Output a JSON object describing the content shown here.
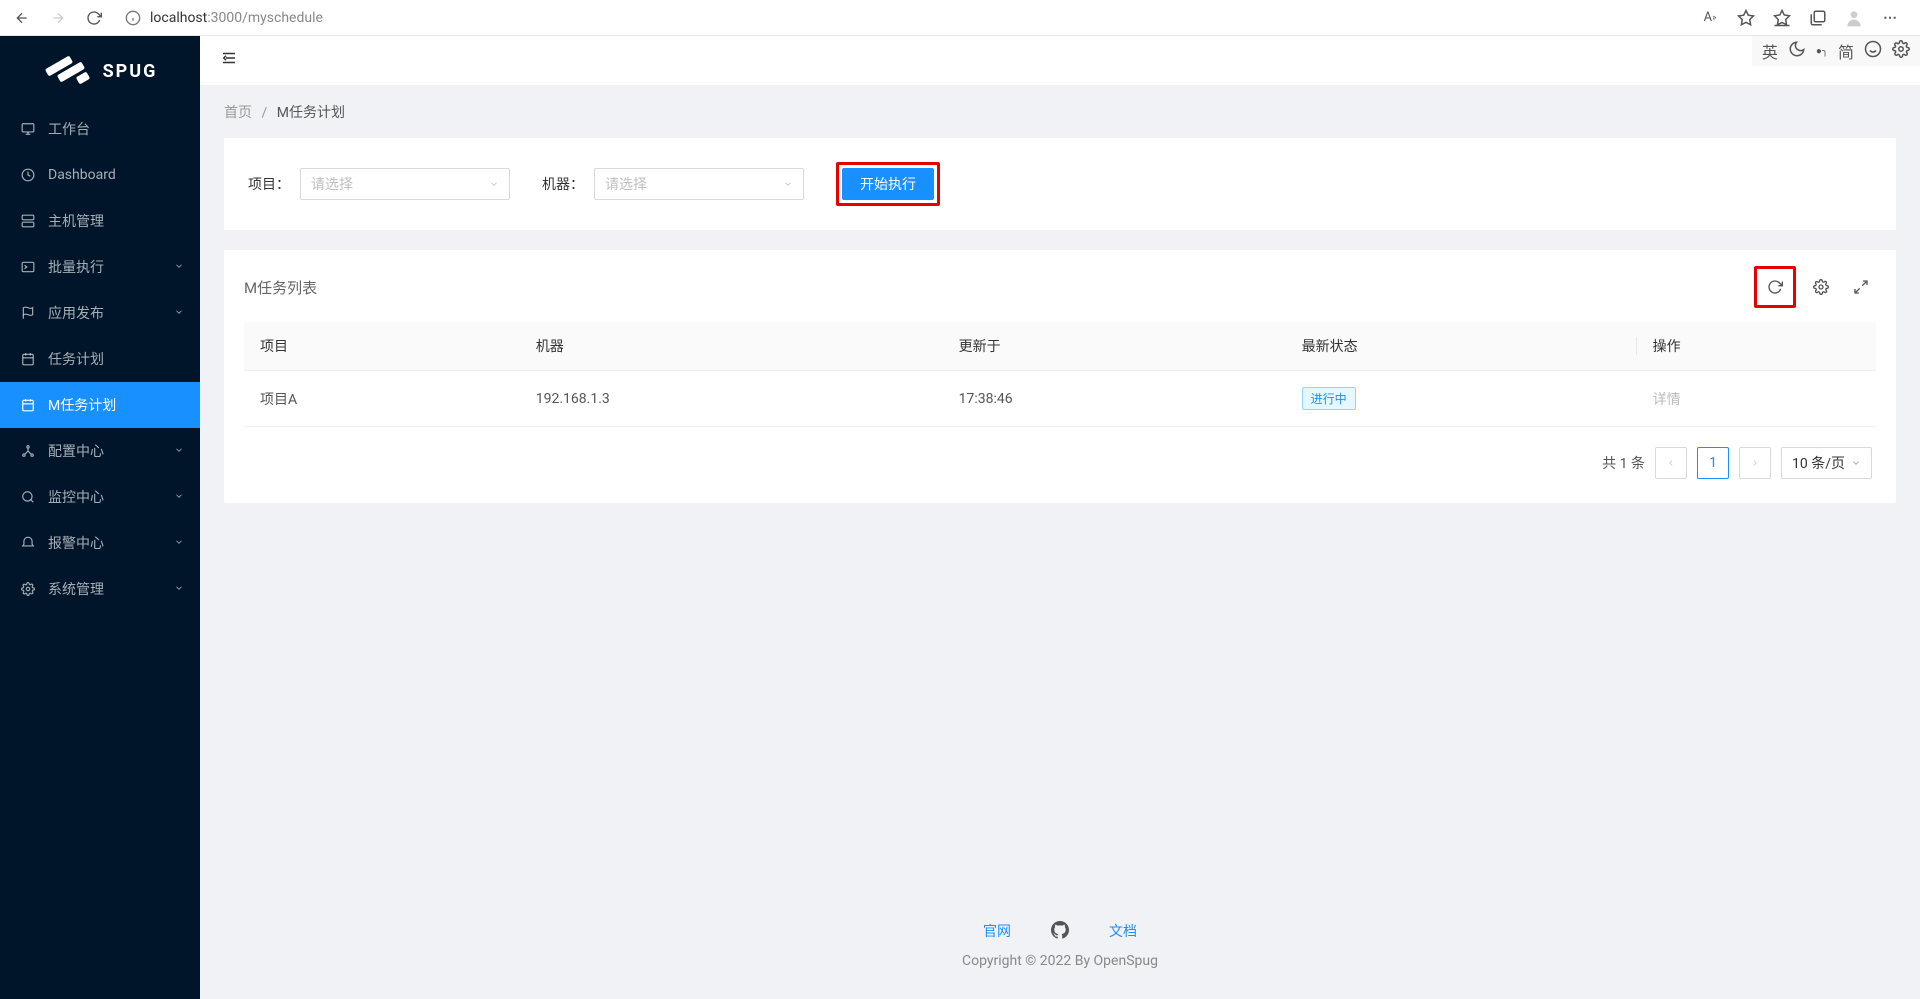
{
  "browser": {
    "url_host": "localhost",
    "url_port_path": ":3000/myschedule"
  },
  "ext_bar": {
    "lang": "英",
    "simp": "简"
  },
  "logo": {
    "text": "SPUG"
  },
  "sidebar": {
    "items": [
      {
        "label": "工作台",
        "expandable": false
      },
      {
        "label": "Dashboard",
        "expandable": false
      },
      {
        "label": "主机管理",
        "expandable": false
      },
      {
        "label": "批量执行",
        "expandable": true
      },
      {
        "label": "应用发布",
        "expandable": true
      },
      {
        "label": "任务计划",
        "expandable": false
      },
      {
        "label": "M任务计划",
        "expandable": false,
        "active": true
      },
      {
        "label": "配置中心",
        "expandable": true
      },
      {
        "label": "监控中心",
        "expandable": true
      },
      {
        "label": "报警中心",
        "expandable": true
      },
      {
        "label": "系统管理",
        "expandable": true
      }
    ]
  },
  "breadcrumb": {
    "home": "首页",
    "sep": "/",
    "current": "M任务计划"
  },
  "filter": {
    "project_label": "项目：",
    "project_placeholder": "请选择",
    "machine_label": "机器：",
    "machine_placeholder": "请选择",
    "submit": "开始执行"
  },
  "table": {
    "title": "M任务列表",
    "headers": {
      "project": "项目",
      "machine": "机器",
      "updated": "更新于",
      "status": "最新状态",
      "action": "操作"
    },
    "rows": [
      {
        "project": "项目A",
        "machine": "192.168.1.3",
        "updated": "17:38:46",
        "status": "进行中",
        "action": "详情"
      }
    ]
  },
  "pagination": {
    "total": "共 1 条",
    "page": "1",
    "size": "10 条/页"
  },
  "footer": {
    "link1": "官网",
    "link2": "文档",
    "copyright": "Copyright © 2022 By OpenSpug"
  }
}
